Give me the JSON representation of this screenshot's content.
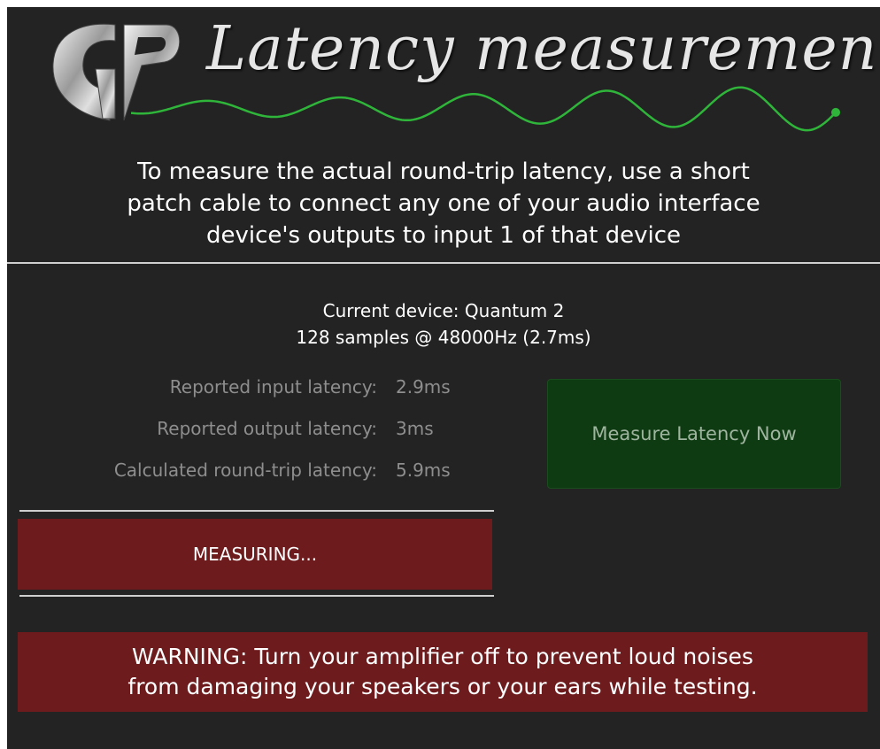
{
  "header": {
    "title": "Latency measurement",
    "logo": "GP",
    "wave_color": "#2fb53a"
  },
  "intro": {
    "line1": "To measure the actual round-trip latency, use a short",
    "line2": "patch cable to connect any one of your audio interface",
    "line3": "device's outputs to input 1 of that device"
  },
  "device": {
    "current": "Current device: Quantum 2",
    "config": "128 samples @ 48000Hz (2.7ms)"
  },
  "stats": [
    {
      "label": "Reported input latency:",
      "value": "2.9ms"
    },
    {
      "label": "Reported output latency:",
      "value": "3ms"
    },
    {
      "label": "Calculated round-trip latency:",
      "value": "5.9ms"
    }
  ],
  "buttons": {
    "measure_label": "Measure Latency Now",
    "measuring_label": "MEASURING..."
  },
  "warning": {
    "line1": "WARNING: Turn your amplifier off to prevent loud noises",
    "line2": "from damaging your speakers or your ears while testing."
  },
  "colors": {
    "background": "#232323",
    "measure_button_bg": "#0f3b12",
    "measuring_bg": "#6e1b1e",
    "warning_bg": "#6e1b1e"
  }
}
